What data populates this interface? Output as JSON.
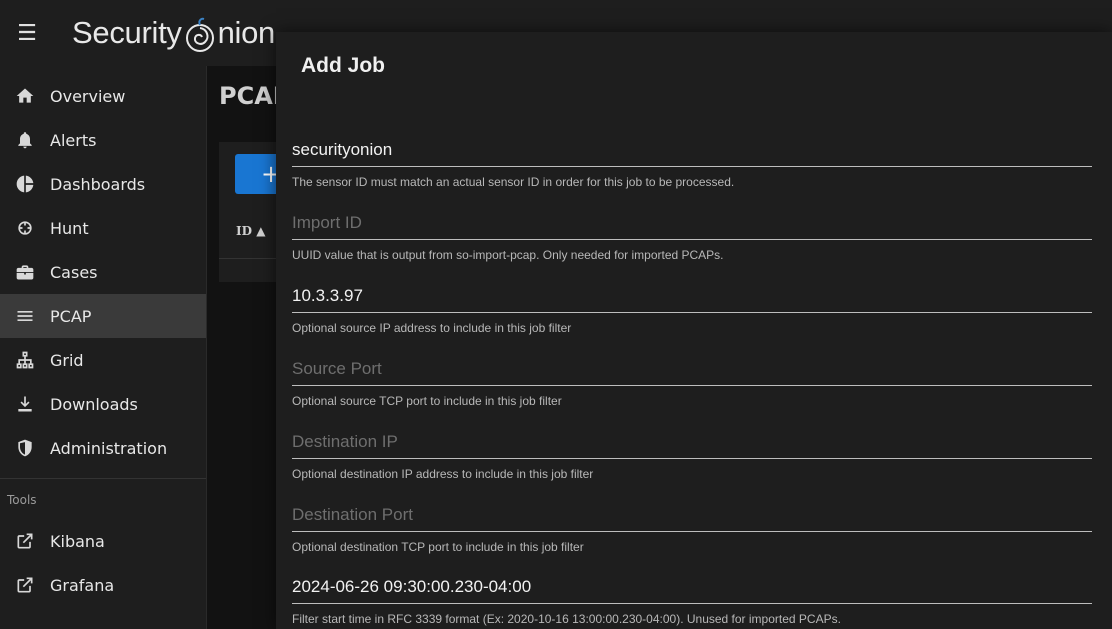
{
  "app": {
    "logo_left": "Security",
    "logo_right": "nion"
  },
  "sidebar": {
    "items": [
      {
        "label": "Overview",
        "icon": "home-icon"
      },
      {
        "label": "Alerts",
        "icon": "bell-icon"
      },
      {
        "label": "Dashboards",
        "icon": "pie-chart-icon"
      },
      {
        "label": "Hunt",
        "icon": "crosshairs-icon"
      },
      {
        "label": "Cases",
        "icon": "briefcase-icon"
      },
      {
        "label": "PCAP",
        "icon": "list-icon",
        "active": true
      },
      {
        "label": "Grid",
        "icon": "sitemap-icon"
      },
      {
        "label": "Downloads",
        "icon": "download-icon"
      },
      {
        "label": "Administration",
        "icon": "shield-icon"
      }
    ],
    "tools_label": "Tools",
    "tools": [
      {
        "label": "Kibana",
        "icon": "external-link-icon"
      },
      {
        "label": "Grafana",
        "icon": "external-link-icon"
      }
    ]
  },
  "main": {
    "title": "PCAP",
    "add_button": "+",
    "id_column": "ID ▲"
  },
  "dialog": {
    "title": "Add Job",
    "fields": [
      {
        "value": "securityonion",
        "placeholder": "",
        "hint": "The sensor ID must match an actual sensor ID in order for this job to be processed."
      },
      {
        "value": "",
        "placeholder": "Import ID",
        "hint": "UUID value that is output from so-import-pcap. Only needed for imported PCAPs."
      },
      {
        "value": "10.3.3.97",
        "placeholder": "",
        "hint": "Optional source IP address to include in this job filter"
      },
      {
        "value": "",
        "placeholder": "Source Port",
        "hint": "Optional source TCP port to include in this job filter"
      },
      {
        "value": "",
        "placeholder": "Destination IP",
        "hint": "Optional destination IP address to include in this job filter"
      },
      {
        "value": "",
        "placeholder": "Destination Port",
        "hint": "Optional destination TCP port to include in this job filter"
      },
      {
        "value": "2024-06-26 09:30:00.230-04:00",
        "placeholder": "",
        "hint": "Filter start time in RFC 3339 format (Ex: 2020-10-16 13:00:00.230-04:00). Unused for imported PCAPs."
      }
    ]
  },
  "colors": {
    "accent": "#1976d2",
    "surface": "#1e1e1e",
    "background": "#121212"
  }
}
